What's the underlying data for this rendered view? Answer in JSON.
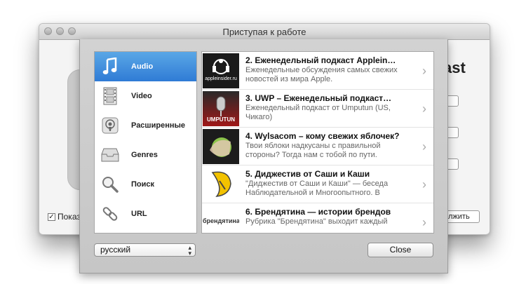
{
  "window": {
    "title": "Приступая к работе"
  },
  "background": {
    "heading_fragment": "ast",
    "button_fragment": "лжить",
    "checkbox_label": "Показ",
    "checkbox_checked": "✓"
  },
  "sidebar": {
    "items": [
      {
        "label": "Audio",
        "icon": "music-note-icon",
        "selected": true
      },
      {
        "label": "Video",
        "icon": "film-strip-icon",
        "selected": false
      },
      {
        "label": "Расширенные",
        "icon": "podcast-icon",
        "selected": false
      },
      {
        "label": "Genres",
        "icon": "drawer-icon",
        "selected": false
      },
      {
        "label": "Поиск",
        "icon": "magnifier-icon",
        "selected": false
      },
      {
        "label": "URL",
        "icon": "link-icon",
        "selected": false
      }
    ]
  },
  "podcasts": [
    {
      "title": "2. Еженедельный подкаст Applein…",
      "desc": "Еженедельные обсуждения самых свежих новостей из мира Apple."
    },
    {
      "title": "3. UWP – Еженедельный подкаст…",
      "desc": "Еженедельный подкаст от Umputun (US, Чикаго)"
    },
    {
      "title": "4. Wylsacom – кому свежих яблочек?",
      "desc": "Твои яблоки надкусаны с правильной стороны? Тогда нам с тобой по пути."
    },
    {
      "title": "5. Диджестив от Саши и Каши",
      "desc": "\"Диджестив от Саши и Каши\" — беседа Наблюдательной и Многоопытного. В"
    },
    {
      "title": "6. Брендятина — истории брендов",
      "desc": "Рубрика \"Брендятина\" выходит каждый"
    }
  ],
  "thumbs": {
    "t1": "appleinsider.ru",
    "t2": "UMPUTUN",
    "t5": "брендятина"
  },
  "footer": {
    "language": "русский",
    "close_label": "Close"
  }
}
